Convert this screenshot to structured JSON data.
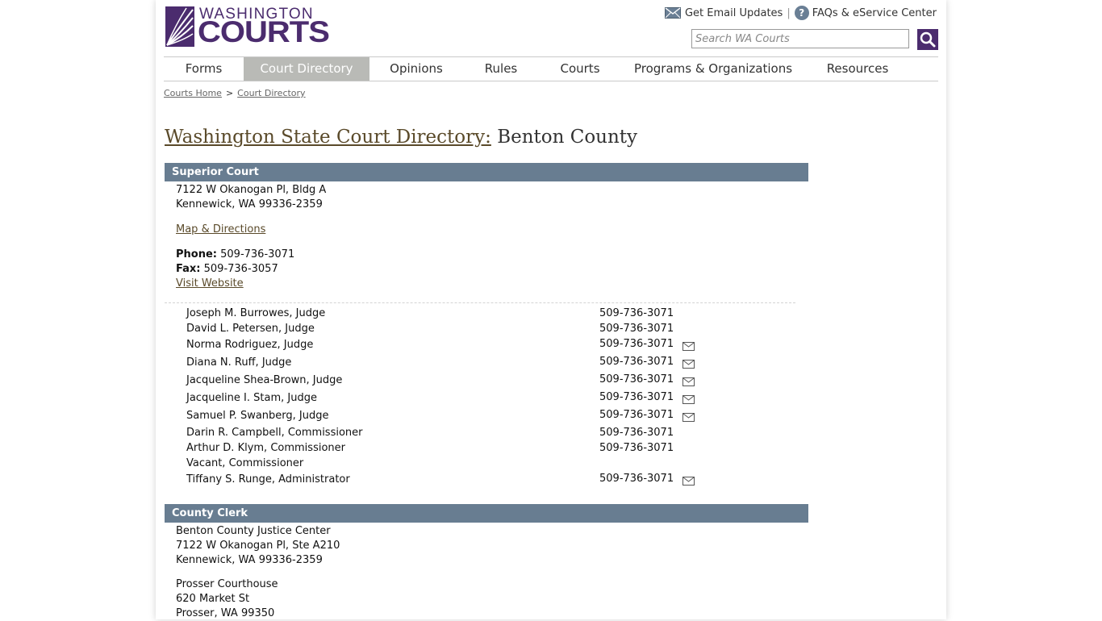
{
  "header": {
    "logo_top": "WASHINGTON",
    "logo_bottom": "COURTS",
    "email_updates": "Get Email Updates",
    "separator": "|",
    "faqs": "FAQs & eService Center",
    "search_placeholder": "Search WA Courts"
  },
  "nav": {
    "items": [
      {
        "label": "Forms"
      },
      {
        "label": "Court Directory",
        "active": true
      },
      {
        "label": "Opinions"
      },
      {
        "label": "Rules"
      },
      {
        "label": "Courts"
      },
      {
        "label": "Programs & Organizations"
      },
      {
        "label": "Resources"
      }
    ]
  },
  "breadcrumb": {
    "home": "Courts Home",
    "separator": ">",
    "current": "Court Directory"
  },
  "title": {
    "link": "Washington State Court Directory:",
    "county": "Benton County"
  },
  "superior_court": {
    "header": "Superior Court",
    "address_line1": "7122 W Okanogan Pl, Bldg A",
    "address_line2": "Kennewick, WA 99336-2359",
    "map_link": "Map & Directions",
    "phone_label": "Phone:",
    "phone": "509-736-3071",
    "fax_label": "Fax:",
    "fax": "509-736-3057",
    "website_link": "Visit Website",
    "staff": [
      {
        "name": "Joseph M. Burrowes, Judge",
        "phone": "509-736-3071",
        "email": false
      },
      {
        "name": "David L. Petersen, Judge",
        "phone": "509-736-3071",
        "email": false
      },
      {
        "name": "Norma Rodriguez, Judge",
        "phone": "509-736-3071",
        "email": true
      },
      {
        "name": "Diana N. Ruff, Judge",
        "phone": "509-736-3071",
        "email": true
      },
      {
        "name": "Jacqueline Shea-Brown, Judge",
        "phone": "509-736-3071",
        "email": true
      },
      {
        "name": "Jacqueline I. Stam, Judge",
        "phone": "509-736-3071",
        "email": true
      },
      {
        "name": "Samuel P. Swanberg, Judge",
        "phone": "509-736-3071",
        "email": true
      },
      {
        "name": "Darin R. Campbell, Commissioner",
        "phone": "509-736-3071",
        "email": false
      },
      {
        "name": "Arthur D. Klym, Commissioner",
        "phone": "509-736-3071",
        "email": false
      },
      {
        "name": "Vacant, Commissioner",
        "phone": "",
        "email": false
      },
      {
        "name": "Tiffany S. Runge, Administrator",
        "phone": "509-736-3071",
        "email": true
      }
    ]
  },
  "county_clerk": {
    "header": "County Clerk",
    "location1_name": "Benton County Justice Center",
    "location1_line1": "7122 W Okanogan Pl, Ste A210",
    "location1_line2": "Kennewick, WA 99336-2359",
    "location2_name": "Prosser Courthouse",
    "location2_line1": "620 Market St",
    "location2_line2": "Prosser, WA 99350"
  },
  "colors": {
    "brand_purple": "#4b2c6e",
    "section_header": "#687d91",
    "nav_active": "#b9bab6",
    "link_brown": "#5a4a2a"
  },
  "icons": {
    "logo": "courts-logo-mark",
    "email": "envelope-icon",
    "help": "question-circle-icon",
    "search": "magnifier-icon"
  }
}
